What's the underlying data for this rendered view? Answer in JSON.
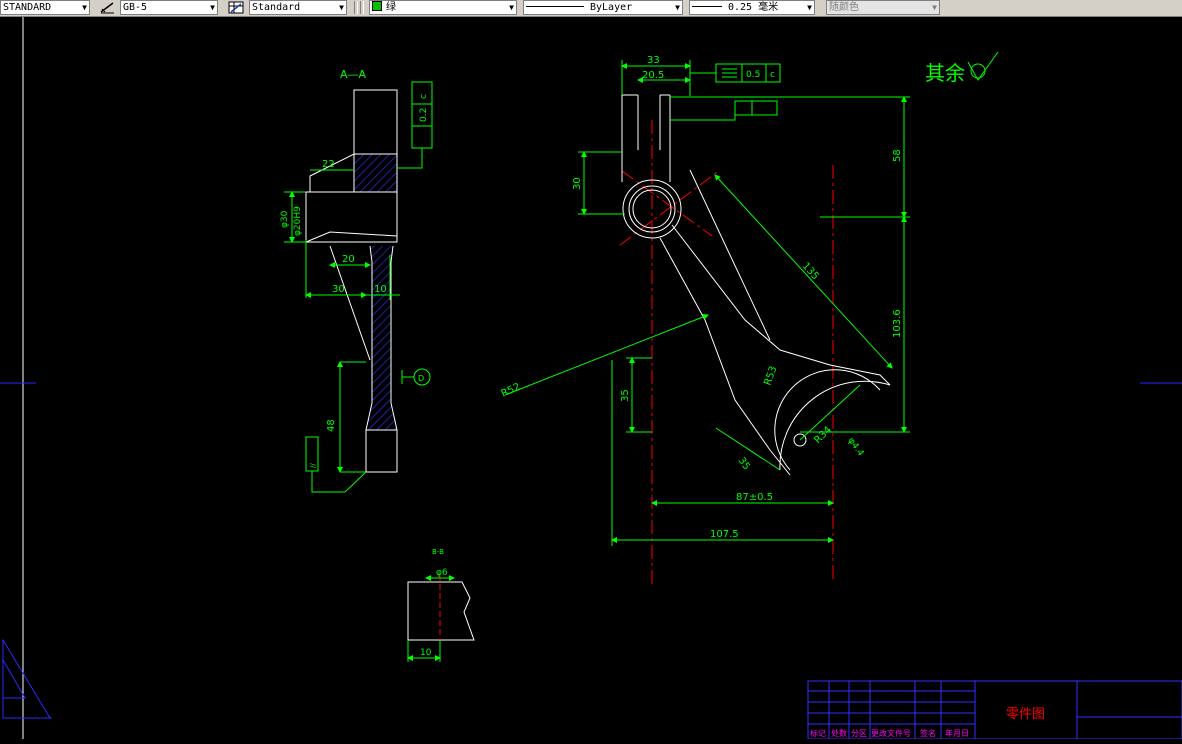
{
  "toolbar": {
    "text_style": "STANDARD",
    "dim_style": "GB-5",
    "table_style": "Standard",
    "layer_color": "绿",
    "linetype": "ByLayer",
    "lineweight": "0.25 毫米",
    "plot_style": "随颜色"
  },
  "colors": {
    "background": "#000000",
    "dimension": "#00ff00",
    "outline": "#ffffff",
    "centerline": "#ff0000",
    "hatch": "#2020c0",
    "titleblock": "#3030ff",
    "titleblock_label": "#ff00ff"
  },
  "drawing": {
    "section_aa_title": "A—A",
    "dim_22": "22",
    "dim_20": "20",
    "dim_30": "30",
    "dim_10": "10",
    "dim_48": "48",
    "dim_phi30": "φ30",
    "dim_phi20": "φ20H9",
    "tol_02": "0.2",
    "tol_c": "c",
    "tol_parallel": "//",
    "datum_d": "D",
    "dim_33": "33",
    "dim_205": "20.5",
    "dim_58": "58",
    "dim_1036": "103.6",
    "dim_30r": "30",
    "dim_r52": "R52",
    "dim_35v": "35",
    "dim_35d": "35",
    "dim_r53": "R53",
    "dim_r34": "R34",
    "dim_phi44": "φ4.4",
    "dim_135": "135",
    "dim_87": "87±0.5",
    "dim_1075": "107.5",
    "tol_05": "0.5",
    "tol_05c": "c",
    "roughness_note": "其余",
    "section_bb_title": "B-B",
    "dim_phi6": "φ6",
    "dim_10b": "10"
  },
  "titleblock": {
    "labels": [
      "标记",
      "处数",
      "分区",
      "更改文件号",
      "签名",
      "年月日"
    ],
    "title": "零件图"
  }
}
